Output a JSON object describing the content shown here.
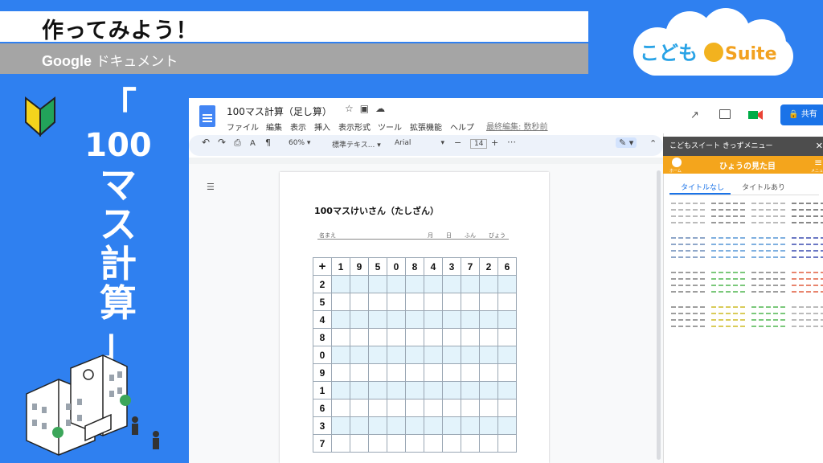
{
  "header": {
    "title": "作ってみよう！",
    "subtitle_brand": "Google",
    "subtitle_rest": " ドキュメント"
  },
  "logo": {
    "text_kodomo": "こども",
    "text_suite": "Suite"
  },
  "vertical_title": [
    "「",
    "100",
    "マ",
    "ス",
    "計",
    "算",
    "」"
  ],
  "doc": {
    "name": "100マス計算（足し算）",
    "menu": [
      "ファイル",
      "編集",
      "表示",
      "挿入",
      "表示形式",
      "ツール",
      "拡張機能",
      "ヘルプ"
    ],
    "last_edit": "最終編集: 数秒前",
    "share_label": "共有",
    "toolbar": {
      "zoom": "60%",
      "style": "標準テキス...",
      "font": "Arial",
      "size": "14"
    }
  },
  "worksheet": {
    "title": "100マスけいさん（たしざん）",
    "name_label": "名まえ",
    "date_labels": [
      "月",
      "日",
      "ふん",
      "びょう"
    ],
    "operator": "+",
    "top_numbers": [
      "1",
      "9",
      "5",
      "0",
      "8",
      "4",
      "3",
      "7",
      "2",
      "6"
    ],
    "left_numbers": [
      "2",
      "5",
      "4",
      "8",
      "0",
      "9",
      "1",
      "6",
      "3",
      "7"
    ]
  },
  "panel": {
    "header": "こどもスイート きっずメニュー",
    "bar_title": "ひょうの見た目",
    "home_label": "ホーム",
    "menu_label": "メニュー",
    "tabs": [
      "タイトルなし",
      "タイトルあり"
    ],
    "swatch_colors": [
      "#bbbbbb",
      "#999999",
      "#bbbbbb",
      "#888888",
      "#8fa7c9",
      "#7fb0e0",
      "#7fb0e0",
      "#6b78c4",
      "#9e9e9e",
      "#7bc87b",
      "#9e9e9e",
      "#e8856e",
      "#9e9e9e",
      "#d9cc5a",
      "#7bc87b",
      "#bbbbbb"
    ]
  },
  "colors": {
    "background": "#2f80f0",
    "share": "#1a73e8",
    "panel_accent": "#f4a51c",
    "table_shade": "#e3f3fb"
  }
}
